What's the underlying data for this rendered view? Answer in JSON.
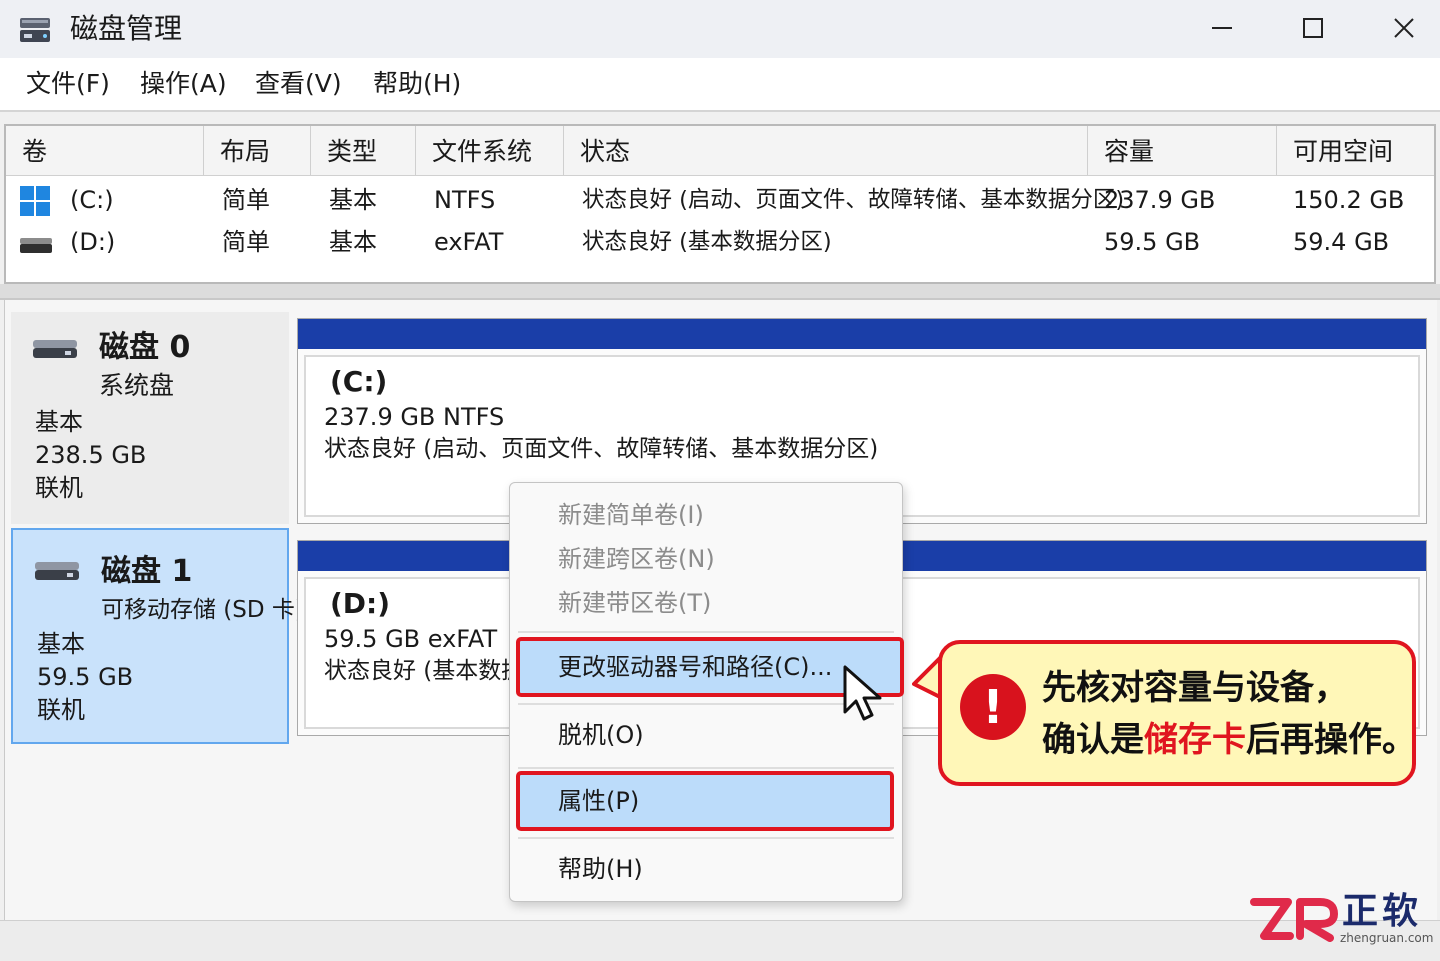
{
  "window": {
    "title": "磁盘管理"
  },
  "menubar": {
    "items": [
      {
        "label": "文件(F)"
      },
      {
        "label": "操作(A)"
      },
      {
        "label": "查看(V)"
      },
      {
        "label": "帮助(H)"
      }
    ]
  },
  "volume_table": {
    "columns": [
      "卷",
      "布局",
      "类型",
      "文件系统",
      "状态",
      "容量",
      "可用空间"
    ],
    "rows": [
      {
        "volume": "(C:)",
        "layout": "简单",
        "type": "基本",
        "fs": "NTFS",
        "status": "状态良好 (启动、页面文件、故障转储、基本数据分区)",
        "capacity": "237.9 GB",
        "free": "150.2 GB",
        "icon": "windows-logo-icon"
      },
      {
        "volume": "(D:)",
        "layout": "简单",
        "type": "基本",
        "fs": "exFAT",
        "status": "状态良好 (基本数据分区)",
        "capacity": "59.5 GB",
        "free": "59.4 GB",
        "icon": "drive-icon"
      }
    ]
  },
  "disks": [
    {
      "name": "磁盘 0",
      "subtitle": "系统盘",
      "type": "基本",
      "size": "238.5 GB",
      "state": "联机",
      "selected": false,
      "partition": {
        "name": "(C:)",
        "size_fs": "237.9 GB NTFS",
        "status": "状态良好 (启动、页面文件、故障转储、基本数据分区)"
      }
    },
    {
      "name": "磁盘 1",
      "subtitle": "可移动存储 (SD 卡)",
      "type": "基本",
      "size": "59.5 GB",
      "state": "联机",
      "selected": true,
      "partition": {
        "name": "(D:)",
        "size_fs": "59.5 GB exFAT",
        "status": "状态良好 (基本数据分区)"
      }
    }
  ],
  "context_menu": {
    "items": [
      {
        "label": "新建简单卷(I)",
        "disabled": true
      },
      {
        "label": "新建跨区卷(N)",
        "disabled": true
      },
      {
        "label": "新建带区卷(T)",
        "disabled": true
      },
      {
        "label": "更改驱动器号和路径(C)...",
        "highlighted": true
      },
      {
        "label": "脱机(O)"
      },
      {
        "label": "属性(P)",
        "highlighted": true
      },
      {
        "label": "帮助(H)"
      }
    ]
  },
  "callout": {
    "line1": "先核对容量与设备，",
    "line2_pre": "确认是",
    "line2_emph": "储存卡",
    "line2_post": "后再操作。"
  },
  "logo": {
    "name_cn": "正软",
    "site": "zhengruan.com"
  },
  "colors": {
    "partition_bar": "#1a3ea8",
    "selection": "#c9e2fb",
    "highlight_border": "#e0151f",
    "callout_bg": "#fff7b8"
  }
}
